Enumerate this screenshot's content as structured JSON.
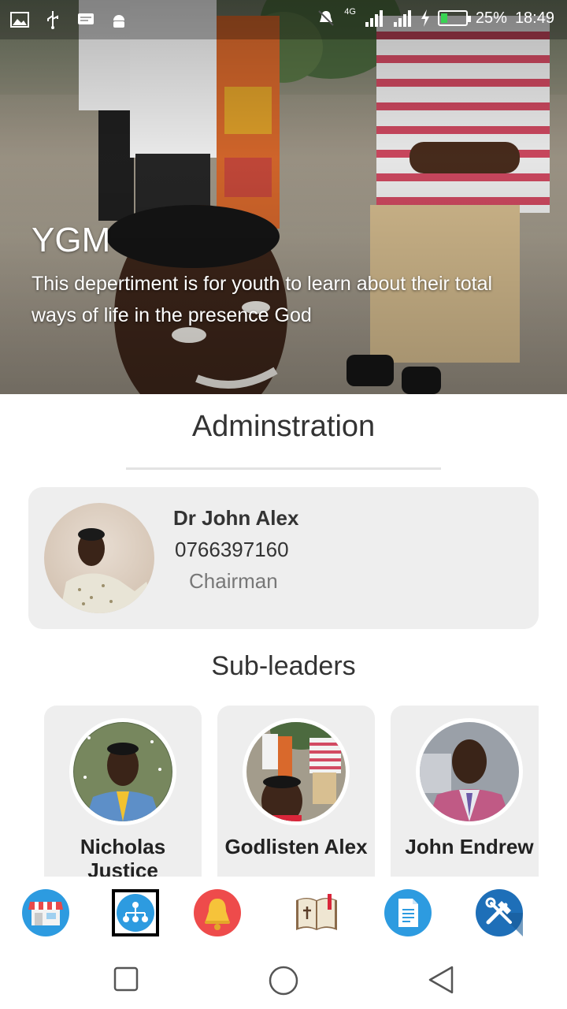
{
  "status_bar": {
    "network": "4G",
    "battery": "25%",
    "time": "18:49"
  },
  "hero": {
    "title": "YGM",
    "description": "This depertiment is for youth to learn about their total ways of life in the presence God"
  },
  "administration": {
    "heading": "Adminstration",
    "leader": {
      "name": "Dr John Alex",
      "phone": "0766397160",
      "role": "Chairman"
    }
  },
  "sub_leaders": {
    "heading": "Sub-leaders",
    "items": [
      {
        "name": "Nicholas Justice"
      },
      {
        "name": "Godlisten Alex"
      },
      {
        "name": "John Endrew"
      }
    ]
  },
  "bottom_nav": {
    "items": [
      {
        "icon": "store-icon"
      },
      {
        "icon": "org-chart-icon",
        "selected": true
      },
      {
        "icon": "bell-icon"
      },
      {
        "icon": "bible-icon"
      },
      {
        "icon": "document-icon"
      },
      {
        "icon": "tools-icon"
      }
    ]
  },
  "colors": {
    "card_bg": "#eeeeee",
    "nav_blue": "#2d9be0",
    "nav_red": "#ee4b4b",
    "tools_blue": "#1e6fb8"
  }
}
